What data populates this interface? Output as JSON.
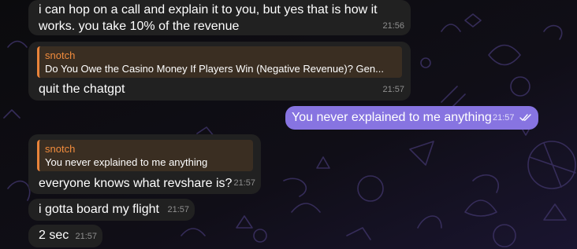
{
  "colors": {
    "incoming_bubble": "#212121",
    "outgoing_bubble": "#8774e1",
    "reply_accent": "#f28c3d",
    "background": "#0e0e10"
  },
  "messages": [
    {
      "direction": "incoming",
      "lines": [
        "i can hop on a call and explain it to you, but yes that is how it",
        "works. you take 10% of the revenue"
      ],
      "time": "21:56"
    },
    {
      "direction": "incoming",
      "reply": {
        "name": "snotch",
        "quote": "Do You Owe the Casino Money If Players Win (Negative Revenue)? Gen..."
      },
      "text": "quit the chatgpt",
      "time": "21:57"
    },
    {
      "direction": "outgoing",
      "text": "You never explained to me anything",
      "time": "21:57",
      "status_icon": "double-check-icon"
    },
    {
      "direction": "incoming",
      "reply": {
        "name": "snotch",
        "quote": "You never explained to me anything"
      },
      "text": "everyone knows what revshare is?",
      "time": "21:57"
    },
    {
      "direction": "incoming",
      "text": "i gotta board my flight",
      "time": "21:57"
    },
    {
      "direction": "incoming",
      "text": "2 sec",
      "time": "21:57"
    }
  ]
}
